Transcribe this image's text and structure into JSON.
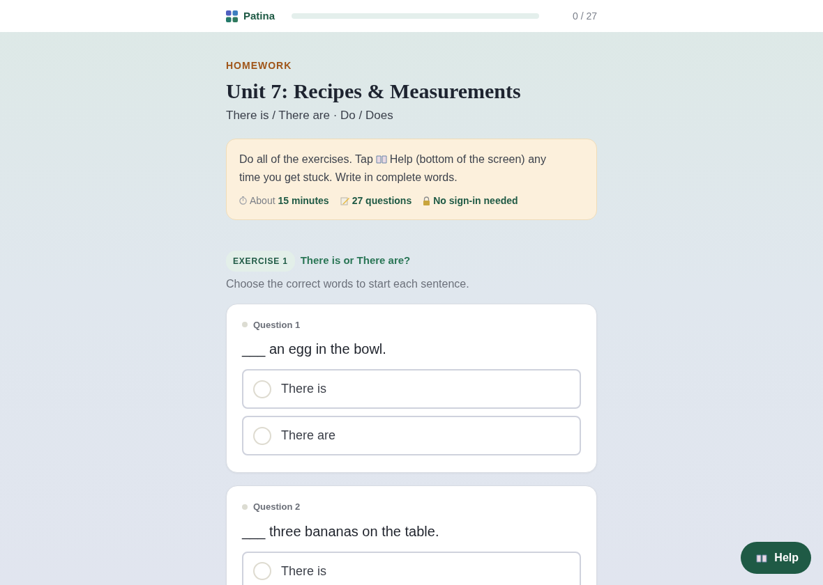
{
  "header": {
    "brand": "Patina",
    "progress": {
      "level": 0
    },
    "count": "0 / 27"
  },
  "eyebrow": "HOMEWORK",
  "title": "Unit 7: Recipes & Measurements",
  "subtitle": "There is / There are · Do / Does",
  "intro": {
    "text_before": "Do all of the exercises. Tap",
    "text_after": "Help (bottom of the screen) any",
    "text_line2": "time you get stuck. Write in complete words.",
    "meta": [
      {
        "kind": "clock",
        "text": "About **15 minutes**"
      },
      {
        "kind": "pencil",
        "text": "27 questions"
      },
      {
        "kind": "lock",
        "text": "No sign-in needed"
      }
    ]
  },
  "exercise": {
    "badge": "EXERCISE 1",
    "title": "There is or There are?",
    "instruction": "Choose the correct words to start each sentence.",
    "questions": [
      {
        "label": "Question 1",
        "prompt": "___ an egg in the bowl.",
        "options": [
          {
            "text": "There is",
            "selected": false
          },
          {
            "text": "There are",
            "selected": false
          }
        ]
      },
      {
        "label": "Question 2",
        "prompt": "___ three bananas on the table.",
        "options": [
          {
            "text": "There is",
            "selected": false
          }
        ]
      }
    ]
  },
  "help_button": "Help"
}
